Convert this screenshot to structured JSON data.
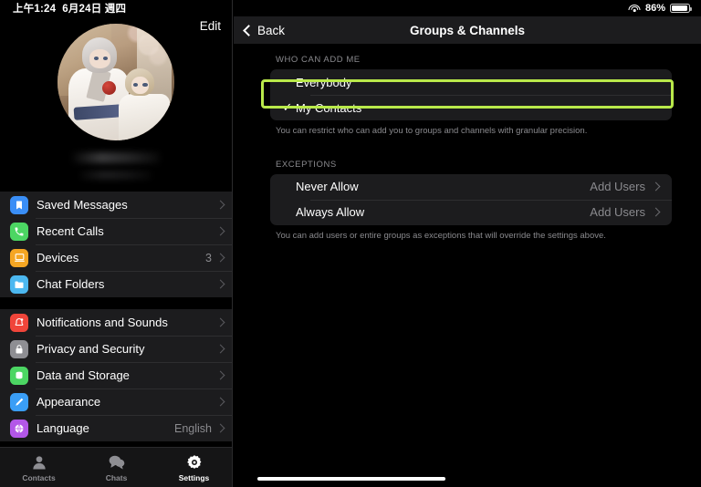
{
  "status_bar": {
    "time": "上午1:24",
    "date": "6月24日 週四",
    "wifi_icon": "wifi-icon",
    "battery_percent": "86%",
    "battery_level": 86
  },
  "sidebar": {
    "edit_label": "Edit",
    "profile": {
      "avatar_name": "user-avatar",
      "name_redacted": true,
      "phone_redacted": true
    },
    "groups": [
      {
        "items": [
          {
            "label": "Saved Messages",
            "icon": "bookmark-icon",
            "color": "#3a8ef6",
            "value": ""
          },
          {
            "label": "Recent Calls",
            "icon": "phone-icon",
            "color": "#4cd663",
            "value": ""
          },
          {
            "label": "Devices",
            "icon": "laptop-icon",
            "color": "#f5a623",
            "value": "3"
          },
          {
            "label": "Chat Folders",
            "icon": "folder-icon",
            "color": "#4cb8f0",
            "value": ""
          }
        ]
      },
      {
        "items": [
          {
            "label": "Notifications and Sounds",
            "icon": "bell-icon",
            "color": "#f0453a",
            "value": ""
          },
          {
            "label": "Privacy and Security",
            "icon": "lock-icon",
            "color": "#8e8e93",
            "value": ""
          },
          {
            "label": "Data and Storage",
            "icon": "database-icon",
            "color": "#4cd663",
            "value": ""
          },
          {
            "label": "Appearance",
            "icon": "brush-icon",
            "color": "#3a9ef6",
            "value": ""
          },
          {
            "label": "Language",
            "icon": "globe-icon",
            "color": "#b357e8",
            "value": "English"
          }
        ]
      }
    ],
    "tabs": [
      {
        "label": "Contacts",
        "icon": "contacts-icon",
        "active": false
      },
      {
        "label": "Chats",
        "icon": "chats-icon",
        "active": false
      },
      {
        "label": "Settings",
        "icon": "settings-gear-icon",
        "active": true
      }
    ]
  },
  "detail": {
    "nav": {
      "back_label": "Back",
      "back_icon": "chevron-left-icon",
      "title": "Groups & Channels"
    },
    "section_who": {
      "header": "WHO CAN ADD ME",
      "options": [
        {
          "label": "Everybody",
          "checked": false
        },
        {
          "label": "My Contacts",
          "checked": true,
          "check_glyph": "✓"
        }
      ],
      "footer": "You can restrict who can add you to groups and channels with granular precision."
    },
    "section_exceptions": {
      "header": "EXCEPTIONS",
      "rows": [
        {
          "label": "Never Allow",
          "action": "Add Users",
          "chevron": "chevron-right-icon"
        },
        {
          "label": "Always Allow",
          "action": "Add Users",
          "chevron": "chevron-right-icon"
        }
      ],
      "footer": "You can add users or entire groups as exceptions that will override the settings above."
    },
    "highlight_color": "#b9e94a",
    "highlighted_element": "My Contacts"
  }
}
